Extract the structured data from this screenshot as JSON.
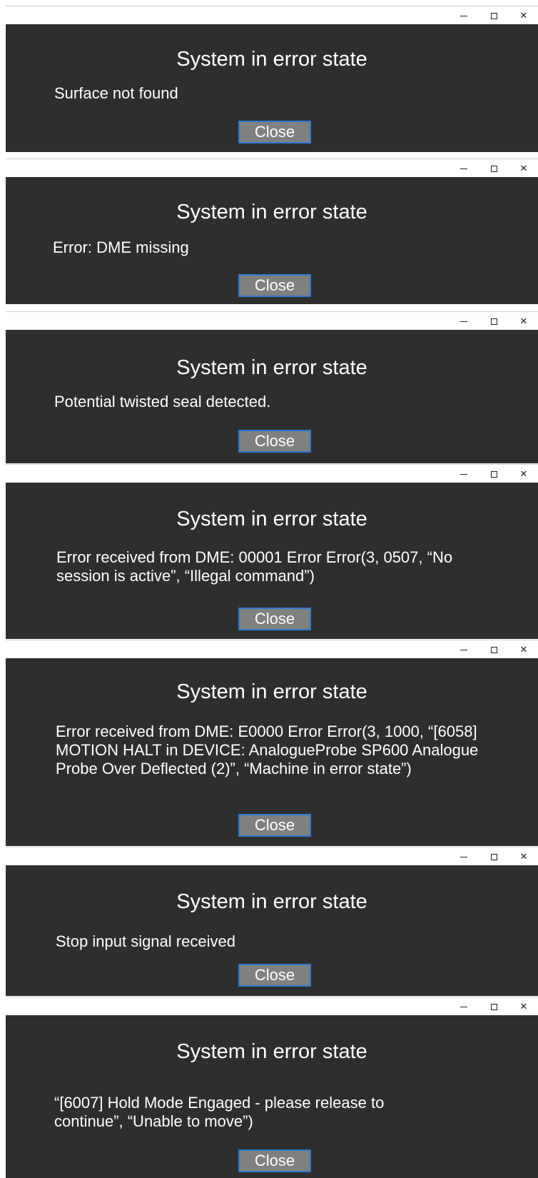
{
  "window_controls": {
    "minimize": "–",
    "maximize": "□",
    "close": "✕"
  },
  "colors": {
    "dialog_bg": "#2e2e2e",
    "button_bg": "#808080",
    "button_border": "#2a7bd6",
    "text": "#ffffff"
  },
  "dialogs": [
    {
      "title": "System in error state",
      "message": "Surface not found",
      "close_label": "Close"
    },
    {
      "title": "System in error state",
      "message": "Error: DME missing",
      "close_label": "Close"
    },
    {
      "title": "System in error state",
      "message": "Potential twisted seal detected.",
      "close_label": "Close"
    },
    {
      "title": "System in error state",
      "message": "Error received from DME: 00001 Error Error(3, 0507, “No session is active”, “Illegal command”)",
      "close_label": "Close"
    },
    {
      "title": "System in error state",
      "message": "Error received from DME: E0000 Error Error(3, 1000, “[6058] MOTION HALT in DEVICE: AnalogueProbe SP600 Analogue Probe Over Deflected (2)”, “Machine in error state”)",
      "close_label": "Close"
    },
    {
      "title": "System in error state",
      "message": "Stop input signal received",
      "close_label": "Close"
    },
    {
      "title": "System in error state",
      "message": "“[6007] Hold Mode Engaged - please release to continue”, “Unable to move”)",
      "close_label": "Close"
    }
  ]
}
